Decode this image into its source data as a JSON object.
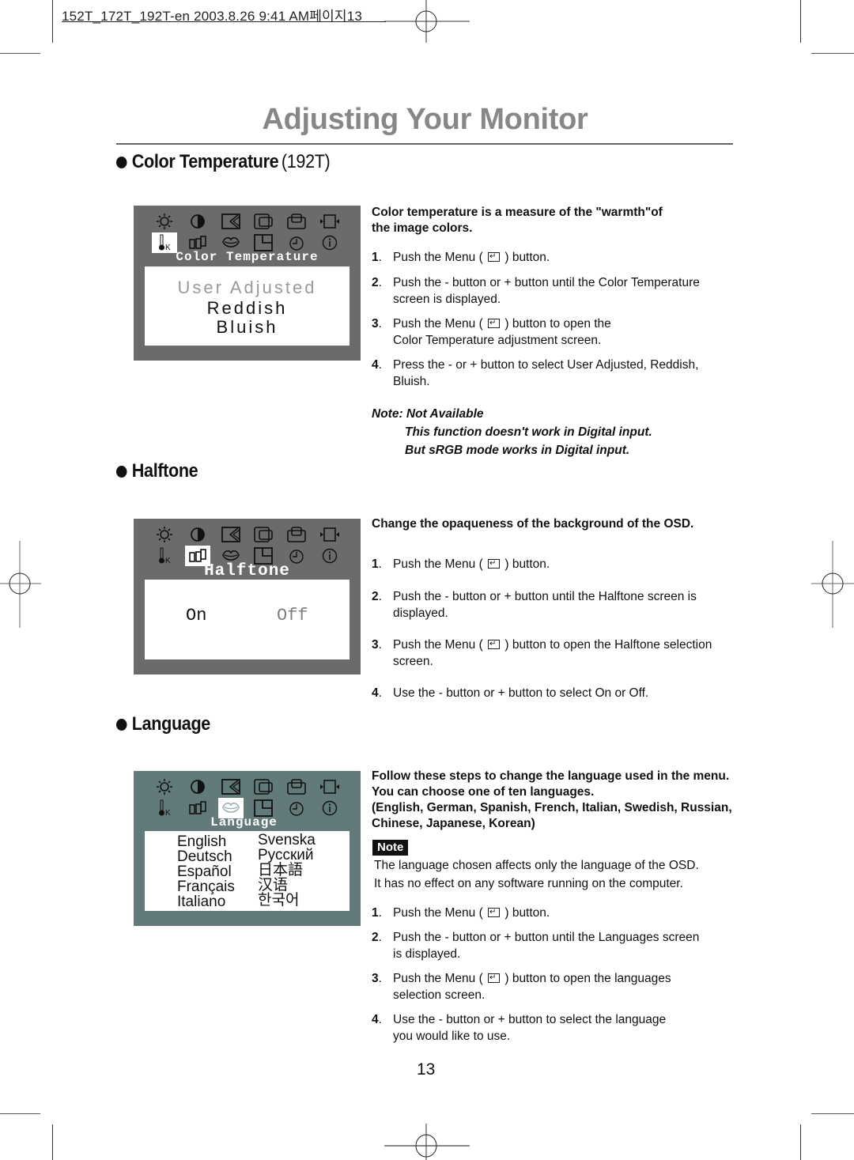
{
  "file_header": "152T_172T_192T-en  2003.8.26 9:41 AM페이지13",
  "page_title": "Adjusting Your Monitor",
  "page_number": "13",
  "colors": {
    "title_gray": "#878787",
    "osd_gray": "#6b6b6b",
    "osd_teal": "#627a7a",
    "text": "#111111"
  },
  "osd_icons": {
    "row1": [
      "brightness-icon",
      "contrast-icon",
      "image-shape-icon",
      "h-position-icon",
      "v-position-icon",
      "size-icon"
    ],
    "row2": [
      "color-temperature-icon",
      "halftone-icon",
      "language-icon",
      "osd-position-icon",
      "osd-time-icon",
      "information-icon"
    ]
  },
  "sections": {
    "color_temperature": {
      "heading": "Color Temperature",
      "heading_suffix": "(192T)",
      "osd": {
        "label": "Color Temperature",
        "selected_icon": "color-temperature-icon",
        "options": [
          "User Adjusted",
          "Reddish",
          "Bluish"
        ],
        "dimmed_option": "User Adjusted"
      },
      "intro": [
        "Color temperature is a measure of the \"warmth\"of",
        "the image colors."
      ],
      "steps": [
        {
          "num": "1",
          "lines": [
            "Push the Menu ( ",
            " ) button."
          ]
        },
        {
          "num": "2",
          "lines": [
            "Push the - button or + button until the Color Temperature",
            "screen is displayed."
          ]
        },
        {
          "num": "3",
          "lines": [
            "Push the Menu ( ",
            " ) button to open the",
            "Color Temperature adjustment screen."
          ]
        },
        {
          "num": "4",
          "lines": [
            "Press the - or + button to select User Adjusted, Reddish,",
            "Bluish."
          ]
        }
      ],
      "note_title": "Note: Not Available",
      "note_lines": [
        "This function doesn't work in Digital input.",
        "But sRGB mode works in Digital input."
      ]
    },
    "halftone": {
      "heading": "Halftone",
      "osd": {
        "label": "Halftone",
        "selected_icon": "halftone-icon",
        "options": [
          "On",
          "Off"
        ],
        "dimmed_option": "Off"
      },
      "intro": [
        "Change the opaqueness of the background of the OSD."
      ],
      "steps": [
        {
          "num": "1",
          "lines": [
            "Push the Menu ( ",
            " ) button."
          ]
        },
        {
          "num": "2",
          "lines": [
            "Push the - button or + button until the Halftone screen is",
            "displayed."
          ]
        },
        {
          "num": "3",
          "lines": [
            "Push the Menu ( ",
            " ) button to open the Halftone selection",
            "screen."
          ]
        },
        {
          "num": "4",
          "lines": [
            "Use the - button or + button to select On or Off."
          ]
        }
      ]
    },
    "language": {
      "heading": "Language",
      "osd": {
        "label": "Language",
        "selected_icon": "language-icon",
        "options_left": [
          "English",
          "Deutsch",
          "Español",
          "Français",
          "Italiano"
        ],
        "options_right": [
          "Svenska",
          "Русский",
          "日本語",
          "汉语",
          "한국어"
        ]
      },
      "intro": [
        "Follow these steps to change the language used in the menu.",
        "You can choose one of ten languages.",
        "(English, German, Spanish, French, Italian, Swedish, Russian,",
        "Chinese, Japanese, Korean)"
      ],
      "note_badge": "Note",
      "note_lines": [
        "The language chosen affects only the language of the OSD.",
        "It has no effect on any software running on the computer."
      ],
      "steps": [
        {
          "num": "1",
          "lines": [
            "Push the Menu ( ",
            " ) button."
          ]
        },
        {
          "num": "2",
          "lines": [
            "Push the - button or + button until the Languages screen",
            "is displayed."
          ]
        },
        {
          "num": "3",
          "lines": [
            "Push the Menu ( ",
            " ) button to open the languages",
            "selection screen."
          ]
        },
        {
          "num": "4",
          "lines": [
            "Use the - button or + button to select the language",
            "you would like to use."
          ]
        }
      ]
    }
  }
}
